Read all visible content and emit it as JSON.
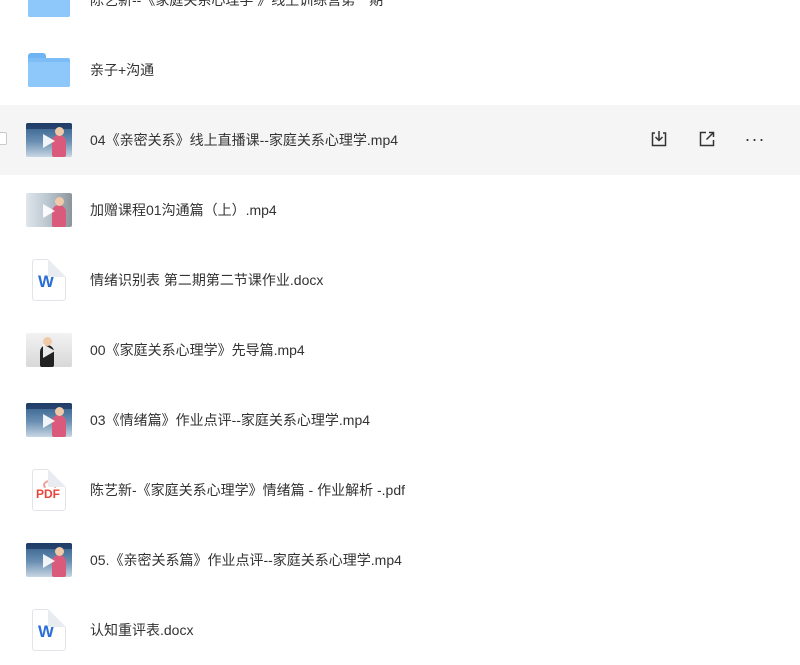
{
  "files": [
    {
      "name": "陈艺新--《家庭关系心理学 》线上训练营第一期",
      "type": "folder",
      "icon": "folder-icon"
    },
    {
      "name": "亲子+沟通",
      "type": "folder",
      "icon": "folder-icon"
    },
    {
      "name": "04《亲密关系》线上直播课--家庭关系心理学.mp4",
      "type": "video",
      "icon": "video-thumbnail"
    },
    {
      "name": "加赠课程01沟通篇（上）.mp4",
      "type": "video",
      "icon": "video-thumbnail"
    },
    {
      "name": "情绪识别表 第二期第二节课作业.docx",
      "type": "word",
      "icon": "word-doc-icon"
    },
    {
      "name": "00《家庭关系心理学》先导篇.mp4",
      "type": "video",
      "icon": "video-thumbnail"
    },
    {
      "name": "03《情绪篇》作业点评--家庭关系心理学.mp4",
      "type": "video",
      "icon": "video-thumbnail"
    },
    {
      "name": "陈艺新-《家庭关系心理学》情绪篇 - 作业解析 -.pdf",
      "type": "pdf",
      "icon": "pdf-doc-icon"
    },
    {
      "name": "05.《亲密关系篇》作业点评--家庭关系心理学.mp4",
      "type": "video",
      "icon": "video-thumbnail"
    },
    {
      "name": "认知重评表.docx",
      "type": "word",
      "icon": "word-doc-icon"
    }
  ],
  "icon_labels": {
    "word": "W",
    "pdf": "PDF"
  },
  "row_actions": {
    "more_label": "···"
  },
  "colors": {
    "hover_row": "#f5f5f6",
    "folder": "#8ec8fa",
    "word": "#2b6fd6",
    "pdf": "#e8453c"
  }
}
